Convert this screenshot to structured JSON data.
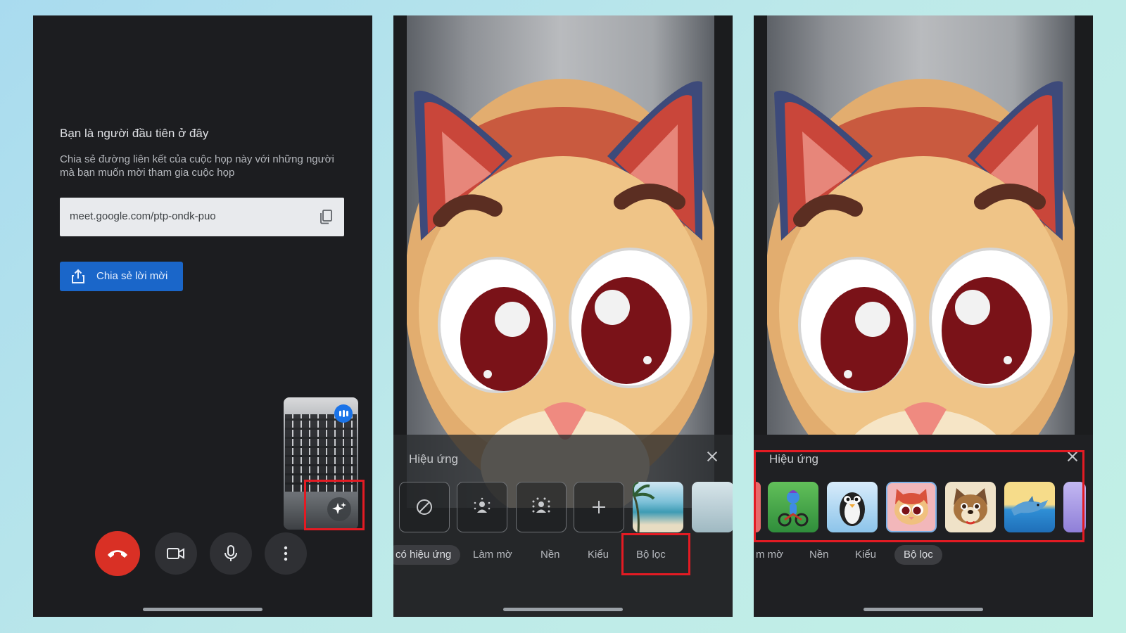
{
  "colors": {
    "accent_blue": "#1a66c9",
    "end_call_red": "#d93025",
    "highlight_red": "#e31b23"
  },
  "panel1": {
    "heading": "Bạn là người đầu tiên ở đây",
    "description": "Chia sẻ đường liên kết của cuộc họp này với những người mà bạn muốn mời tham gia cuộc họp",
    "meeting_link": "meet.google.com/ptp-ondk-puo",
    "share_button": "Chia sẻ lời mời",
    "icons": {
      "copy": "copy-icon",
      "share": "share-icon",
      "speaking": "audio-level-icon",
      "effects": "sparkle-icon",
      "end_call": "end-call-icon",
      "camera": "video-camera-icon",
      "mic": "microphone-icon",
      "more": "more-vert-icon"
    }
  },
  "panel2": {
    "sheet_title": "Hiệu ứng",
    "effect_tiles": [
      "no-effect-icon",
      "slight-blur-icon",
      "blur-icon",
      "add-icon",
      "beach-background",
      "background-thumbnail"
    ],
    "tabs": [
      {
        "label": "có hiệu ứng",
        "active": true
      },
      {
        "label": "Làm mờ",
        "active": false
      },
      {
        "label": "Nền",
        "active": false
      },
      {
        "label": "Kiểu",
        "active": false
      },
      {
        "label": "Bộ lọc",
        "active": false
      }
    ]
  },
  "panel3": {
    "sheet_title": "Hiệu ứng",
    "filter_tiles": [
      "partial-filter-thumbnail",
      "cyclist-filter",
      "penguin-filter",
      "cat-filter",
      "dog-filter",
      "dolphin-filter",
      "partial-filter-thumbnail"
    ],
    "tabs": [
      {
        "label": "m mờ",
        "active": false
      },
      {
        "label": "Nền",
        "active": false
      },
      {
        "label": "Kiểu",
        "active": false
      },
      {
        "label": "Bộ lọc",
        "active": true
      }
    ]
  }
}
